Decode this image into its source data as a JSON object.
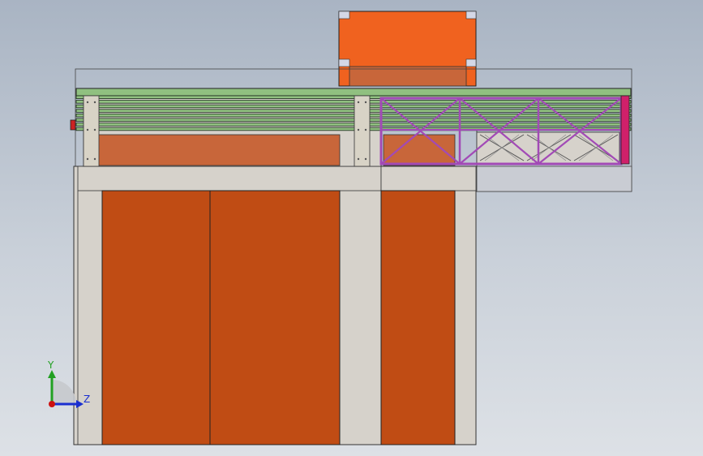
{
  "viewport": {
    "background_top": "#a9b4c3",
    "background_bottom": "#dde1e6"
  },
  "model": {
    "orange_panel_color": "#c04c14",
    "top_box_color": "#f0621f",
    "frame_color": "#d6d2cb",
    "conveyor_green": "#90c080",
    "truss_color": "#a24ab6",
    "end_cap_color": "#d0206a"
  },
  "triad": {
    "y_label": "Y",
    "z_label": "Z",
    "y_color": "#22a022",
    "z_color": "#1a2fd0",
    "x_color": "#cc1111"
  }
}
